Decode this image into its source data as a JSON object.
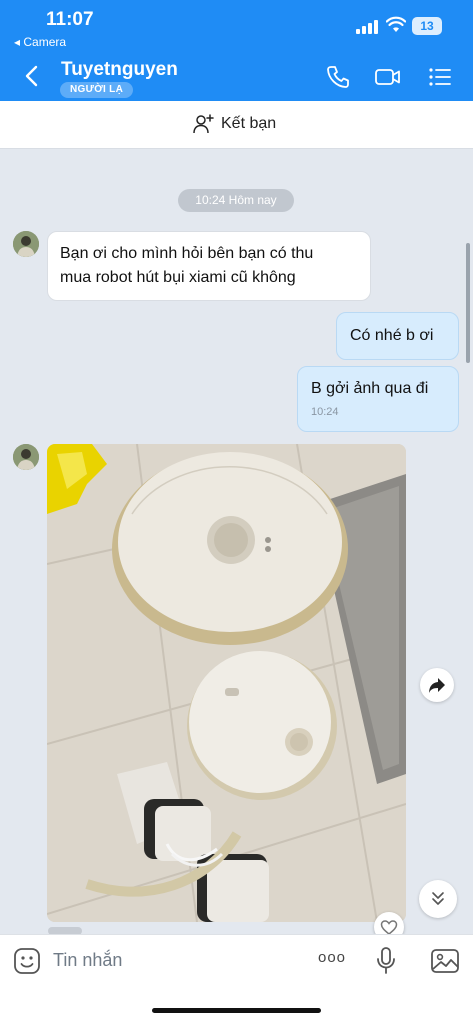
{
  "status_bar": {
    "time": "11:07",
    "back_app": "◂ Camera",
    "battery": "13"
  },
  "header": {
    "title": "Tuyetnguyen",
    "badge": "NGƯỜI LẠ"
  },
  "add_friend": {
    "label": "Kết bạn"
  },
  "chat": {
    "time_separator": "10:24 Hôm nay",
    "messages": [
      {
        "direction": "incoming",
        "line1": "Bạn ơi cho mình hỏi bên bạn có thu",
        "line2": "mua robot hút bụi xiami cũ không"
      },
      {
        "direction": "outgoing",
        "text": "Có nhé b ơi"
      },
      {
        "direction": "outgoing",
        "text": "B gởi ảnh qua đi",
        "time": "10:24"
      }
    ]
  },
  "composer": {
    "placeholder": "Tin nhắn",
    "more_label": "ooo"
  },
  "colors": {
    "header_blue": "#1f8cf5",
    "chat_bg": "#e3e8ef",
    "outgoing_bubble": "#d7ecfd"
  },
  "icons": [
    "back-chevron-icon",
    "phone-icon",
    "video-call-icon",
    "menu-list-icon",
    "add-user-icon",
    "share-forward-icon",
    "double-chevron-down-icon",
    "heart-icon",
    "sticker-icon",
    "microphone-icon",
    "image-icon"
  ]
}
